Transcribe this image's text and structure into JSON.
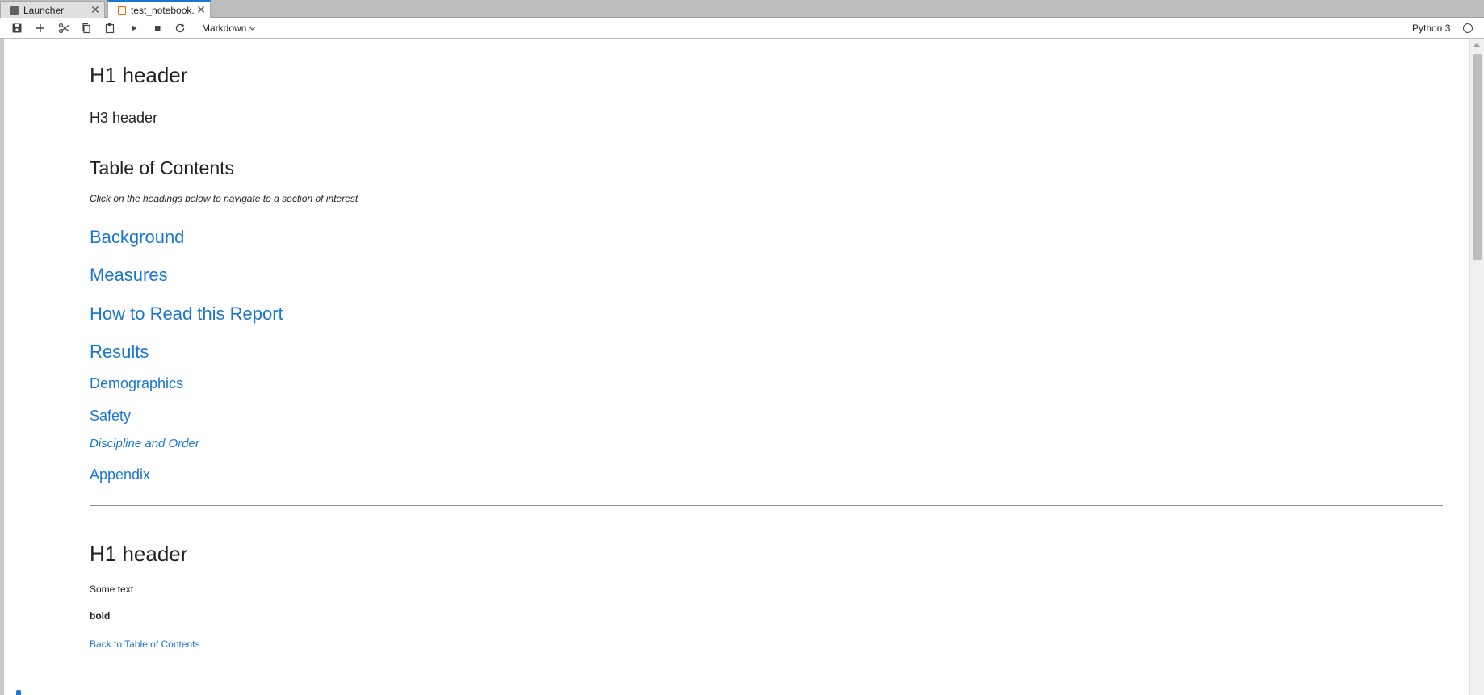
{
  "tabs": [
    {
      "label": "Launcher",
      "icon": "launcher-icon",
      "close_icon": "close-icon"
    },
    {
      "label": "test_notebook.i",
      "icon": "notebook-icon",
      "close_icon": "close-icon",
      "active": true
    }
  ],
  "toolbar": {
    "buttons": [
      "save-icon",
      "add-cell-icon",
      "cut-icon",
      "copy-icon",
      "paste-icon",
      "run-icon",
      "stop-icon",
      "restart-icon"
    ],
    "cell_type": "Markdown",
    "kernel_name": "Python 3",
    "kernel_status_icon": "kernel-idle-circle-icon"
  },
  "notebook": {
    "h1_top": "H1 header",
    "h3": "H3 header",
    "toc_title": "Table of Contents",
    "toc_note": "Click on the headings below to navigate to a section of interest",
    "toc_links": {
      "background": "Background",
      "measures": "Measures",
      "how_to_read": "How to Read this Report",
      "results": "Results",
      "demographics": "Demographics",
      "safety": "Safety",
      "discipline": "Discipline and Order",
      "appendix": "Appendix"
    },
    "section_h1": "H1 header",
    "some_text": "Some text",
    "bold_text": "bold",
    "back_link": "Back to Table of Contents"
  },
  "colors": {
    "link": "#1976d2",
    "active_tab_accent": "#1976d2",
    "tabbar_bg": "#bdbdbd"
  }
}
